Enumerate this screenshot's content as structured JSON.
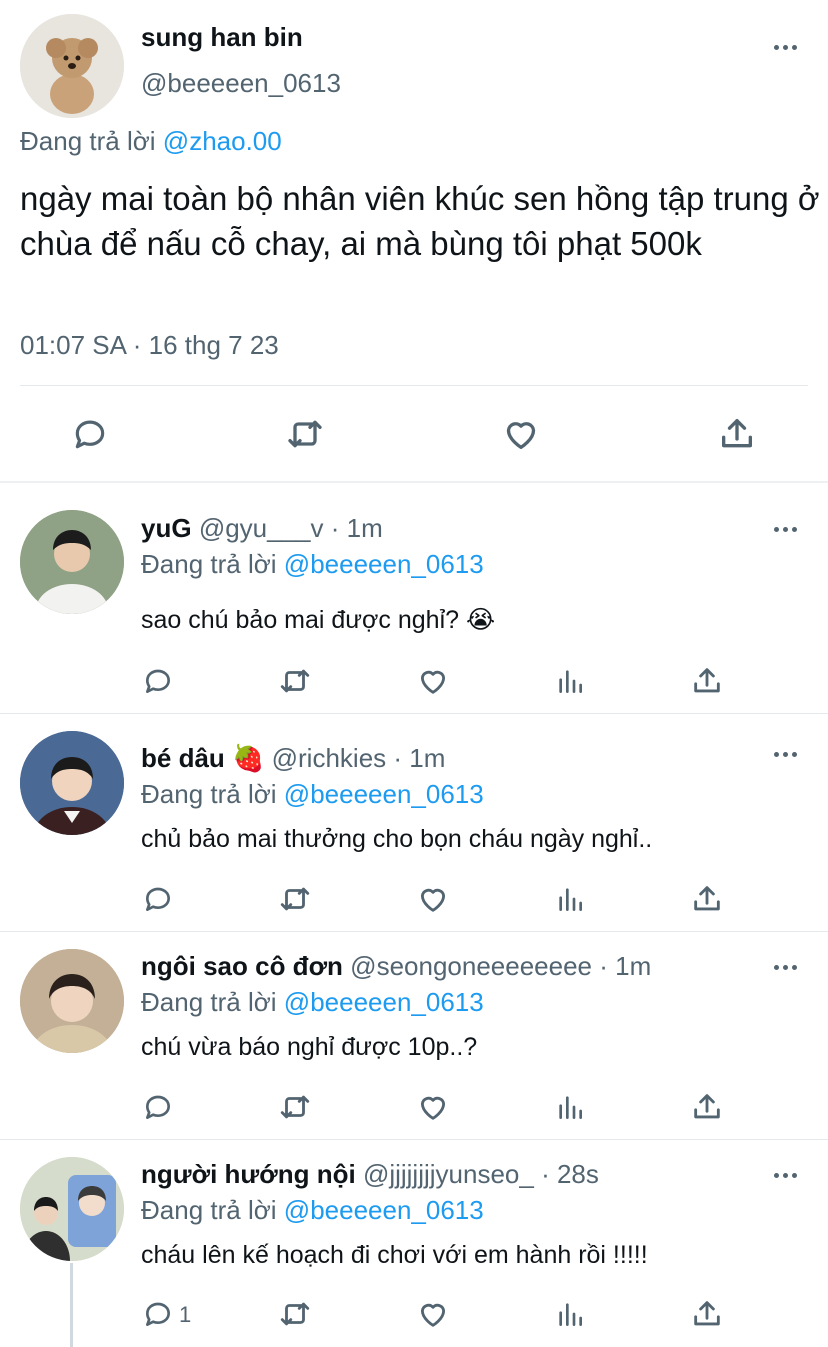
{
  "main_tweet": {
    "display_name": "sung han bin",
    "handle": "@beeeeen_0613",
    "replying_prefix": "Đang trả lời",
    "replying_to": "@zhao.00",
    "text": "ngày mai toàn bộ nhân viên khúc sen hồng tập trung ở chùa để nấu cỗ chay, ai mà bùng tôi phạt 500k",
    "timestamp": "01:07 SA · 16 thg 7 23",
    "actions": [
      "reply-icon",
      "retweet-icon",
      "like-icon",
      "share-icon"
    ]
  },
  "replies": [
    {
      "display_name": "yuG",
      "handle": "@gyu___v",
      "time": "· 1m",
      "replying_prefix": "Đang trả lời",
      "replying_to": "@beeeeen_0613",
      "text": "sao chú bảo mai được nghỉ? 😭",
      "reply_count": ""
    },
    {
      "display_name": "bé dâu 🍓",
      "handle": "@richkies",
      "time": "· 1m",
      "replying_prefix": "Đang trả lời",
      "replying_to": "@beeeeen_0613",
      "text": "chủ bảo mai thưởng cho bọn cháu ngày nghỉ..",
      "reply_count": ""
    },
    {
      "display_name": "ngôi sao cô đơn",
      "handle": "@seongoneeeeeeee",
      "time": "· 1m",
      "replying_prefix": "Đang trả lời",
      "replying_to": "@beeeeen_0613",
      "text": "chú vừa báo nghỉ được 10p..?",
      "reply_count": ""
    },
    {
      "display_name": "người hướng nội",
      "handle": "@jjjjjjjjyunseo_",
      "time": "· 28s",
      "replying_prefix": "Đang trả lời",
      "replying_to": "@beeeeen_0613",
      "text": "cháu lên kế hoạch đi chơi với em hành rồi !!!!!",
      "reply_count": "1"
    }
  ],
  "colors": {
    "link": "#1d9bf0",
    "muted": "#536471",
    "text": "#0f1419"
  }
}
